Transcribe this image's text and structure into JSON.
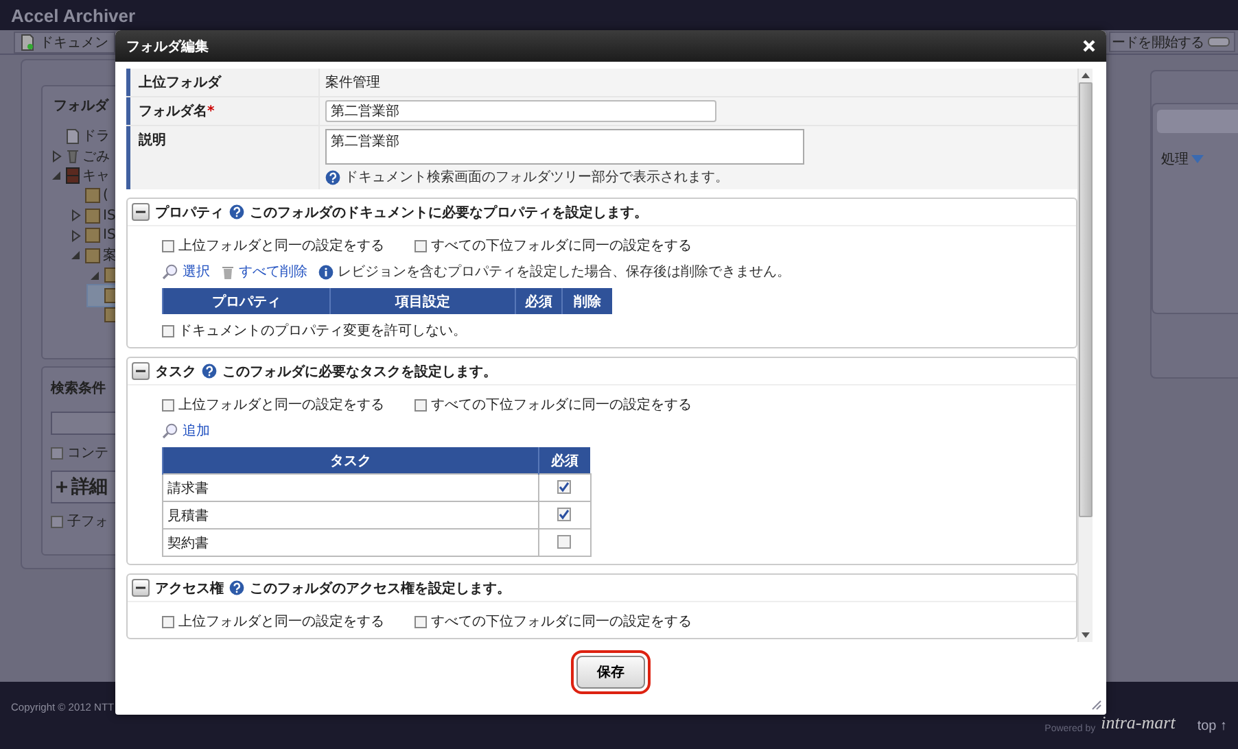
{
  "app": {
    "title": "Accel Archiver"
  },
  "toolbar": {
    "left_button": "ドキュメン",
    "right_button": "ードを開始する"
  },
  "folder_panel": {
    "title": "フォルダ",
    "tree": [
      {
        "label": "ドラ",
        "kind": "draft",
        "selected": false
      },
      {
        "label": "ごみ",
        "kind": "trash",
        "expanded": false,
        "selected": false
      },
      {
        "label": "キャ",
        "kind": "cabinet",
        "expanded": true,
        "selected": false,
        "children": [
          {
            "label": "(",
            "kind": "folder",
            "selected": false
          },
          {
            "label": "IS",
            "kind": "folder",
            "expanded": false,
            "selected": false
          },
          {
            "label": "IS",
            "kind": "folder",
            "expanded": false,
            "selected": false
          },
          {
            "label": "案",
            "kind": "folder",
            "expanded": true,
            "selected": false,
            "children": [
              {
                "kind": "folder",
                "expanded": true,
                "selected": false
              },
              {
                "kind": "folder",
                "selected": true
              },
              {
                "kind": "folder",
                "selected": false
              }
            ]
          }
        ]
      }
    ]
  },
  "search_panel": {
    "title": "検索条件",
    "content_option": {
      "label": "コンテ",
      "checked": false
    },
    "detail_button": "詳細",
    "child_option": {
      "label": "子フォ",
      "checked": false
    }
  },
  "right_panel": {
    "menu": "処理"
  },
  "footer": {
    "copyright": "Copyright © 2012 NTT",
    "powered_by": "Powered by",
    "brand": "intra-mart",
    "top_link": "top ↑"
  },
  "dialog": {
    "title": "フォルダ編集",
    "fields": [
      {
        "label": "上位フォルダ",
        "kind": "text",
        "value": "案件管理"
      },
      {
        "label": "フォルダ名",
        "required_mark": "*",
        "kind": "input",
        "value": "第二営業部"
      },
      {
        "label": "説明",
        "kind": "textarea",
        "value": "第二営業部",
        "help": "ドキュメント検索画面のフォルダツリー部分で表示されます。"
      }
    ],
    "sections": [
      {
        "title": "プロパティ",
        "expanded": true,
        "description": "このフォルダのドキュメントに必要なプロパティを設定します。",
        "options": [
          {
            "label": "上位フォルダと同一の設定をする",
            "checked": false
          },
          {
            "label": "すべての下位フォルダに同一の設定をする",
            "checked": false
          }
        ],
        "actions": [
          {
            "label": "選択",
            "kind": "search"
          },
          {
            "label": "すべて削除",
            "kind": "delete"
          }
        ],
        "note": "レビジョンを含むプロパティを設定した場合、保存後は削除できません。",
        "table": {
          "kind": "property",
          "columns": [
            "プロパティ",
            "項目設定",
            "必須",
            "削除"
          ]
        },
        "footer_option": {
          "label": "ドキュメントのプロパティ変更を許可しない。",
          "checked": false
        }
      },
      {
        "title": "タスク",
        "expanded": true,
        "description": "このフォルダに必要なタスクを設定します。",
        "options": [
          {
            "label": "上位フォルダと同一の設定をする",
            "checked": false
          },
          {
            "label": "すべての下位フォルダに同一の設定をする",
            "checked": false
          }
        ],
        "actions": [
          {
            "label": "追加",
            "kind": "search"
          }
        ],
        "table": {
          "kind": "task",
          "columns": [
            "タスク",
            "必須"
          ],
          "rows": [
            {
              "name": "請求書",
              "required": true
            },
            {
              "name": "見積書",
              "required": true
            },
            {
              "name": "契約書",
              "required": false
            }
          ]
        }
      },
      {
        "title": "アクセス権",
        "expanded": true,
        "description": "このフォルダのアクセス権を設定します。",
        "options": [
          {
            "label": "上位フォルダと同一の設定をする",
            "checked": false
          },
          {
            "label": "すべての下位フォルダに同一の設定をする",
            "checked": false
          }
        ]
      }
    ],
    "save_button": "保存"
  }
}
